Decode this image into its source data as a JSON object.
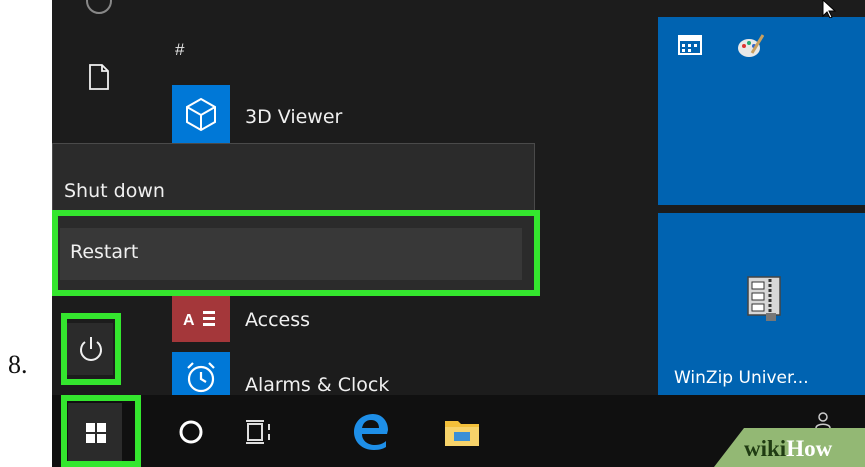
{
  "step_number": "8.",
  "start_menu": {
    "section_header": "#",
    "apps": {
      "viewer": "3D Viewer",
      "access": "Access",
      "alarms": "Alarms & Clock"
    },
    "access_glyph": "A",
    "power_menu": {
      "shut_down": "Shut down",
      "restart": "Restart"
    }
  },
  "tiles": {
    "winzip": "WinZip Univer..."
  },
  "watermark": {
    "wiki": "wiki",
    "how": "How"
  },
  "icons": [
    "document-icon",
    "cube-icon",
    "access-icon",
    "alarm-clock-icon",
    "power-icon",
    "windows-logo-icon",
    "cortana-icon",
    "task-view-icon",
    "edge-icon",
    "file-explorer-icon",
    "calendar-icon",
    "paint-icon",
    "winzip-icon",
    "people-icon",
    "cursor-icon"
  ],
  "colors": {
    "highlight": "#34e62e",
    "tile_blue": "#0063b1",
    "access_red": "#a4373a"
  }
}
